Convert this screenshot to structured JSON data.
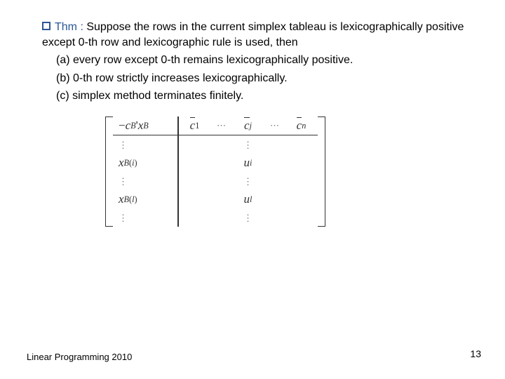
{
  "thm_label": "Thm :",
  "thm_text": "  Suppose the rows in the current simplex tableau is lexicographically positive except 0-th row and lexicographic rule is used, then",
  "item_a": "(a) every row except 0-th remains lexicographically positive.",
  "item_b": "(b) 0-th row strictly increases lexicographically.",
  "item_c": "(c) simplex method terminates finitely.",
  "tab": {
    "tl": "−c_B' x_B",
    "c1": "c̄_1",
    "cj": "c̄_j",
    "cn": "c̄_n",
    "xbi": "x_B(i)",
    "xbl": "x_B(l)",
    "ui": "u_i",
    "ul": "u_l",
    "dots": "⋯",
    "vdots": "⋮"
  },
  "footer_left": "Linear Programming 2010",
  "footer_right": "13"
}
